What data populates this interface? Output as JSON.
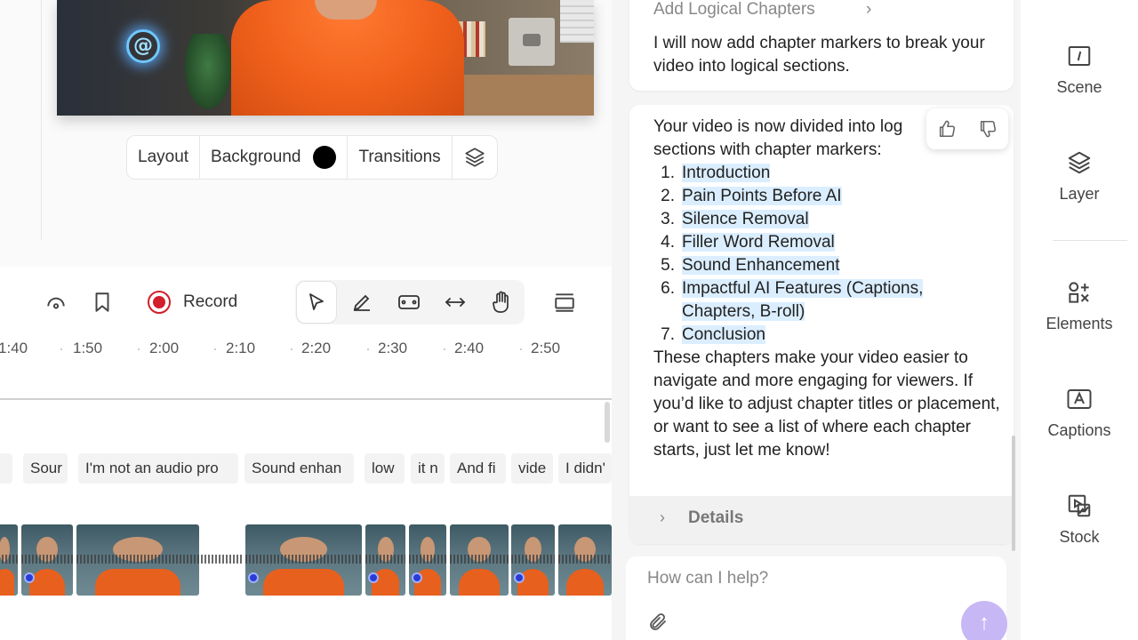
{
  "layout_toolbar": {
    "layout_label": "Layout",
    "background_label": "Background",
    "background_color": "#000000",
    "transitions_label": "Transitions"
  },
  "playback": {
    "record_label": "Record",
    "record_color": "#d21f2b"
  },
  "ruler_ticks": [
    "1:40",
    "1:50",
    "2:00",
    "2:10",
    "2:20",
    "2:30",
    "2:40",
    "2:50"
  ],
  "caption_chips": [
    "Sour",
    "I'm not an audio pro",
    "Sound enhan",
    "low",
    "it n",
    "And fi",
    "vide",
    "I didn'"
  ],
  "chat": {
    "step_title": "Add Logical Chapters",
    "step_text": "I will now add chapter markers to break your video into logical sections.",
    "answer_intro_line1": "Your video is now divided into log",
    "answer_intro_line2": "sections with chapter markers:",
    "chapters": [
      {
        "num": "1.",
        "title": "Introduction"
      },
      {
        "num": "2.",
        "title": "Pain Points Before AI"
      },
      {
        "num": "3.",
        "title": "Silence Removal"
      },
      {
        "num": "4.",
        "title": "Filler Word Removal"
      },
      {
        "num": "5.",
        "title": "Sound Enhancement"
      },
      {
        "num": "6.",
        "title": "Impactful AI Features (Captions, Chapters, B-roll)"
      },
      {
        "num": "7.",
        "title": "Conclusion"
      }
    ],
    "answer_outro": "These chapters make your video easier to navigate and more engaging for viewers. If you’d like to adjust chapter titles or placement, or want to see a list of where each chapter starts, just let me know!",
    "details_label": "Details",
    "input_placeholder": "How can I help?",
    "highlight_color": "#dbeeff",
    "send_button_color": "#c7b8f5"
  },
  "sidebar": {
    "items": [
      {
        "label": "Scene",
        "icon": "scene-icon"
      },
      {
        "label": "Layer",
        "icon": "layers-icon"
      },
      {
        "label": "Elements",
        "icon": "elements-icon"
      },
      {
        "label": "Captions",
        "icon": "captions-icon"
      },
      {
        "label": "Stock",
        "icon": "stock-icon"
      }
    ]
  }
}
